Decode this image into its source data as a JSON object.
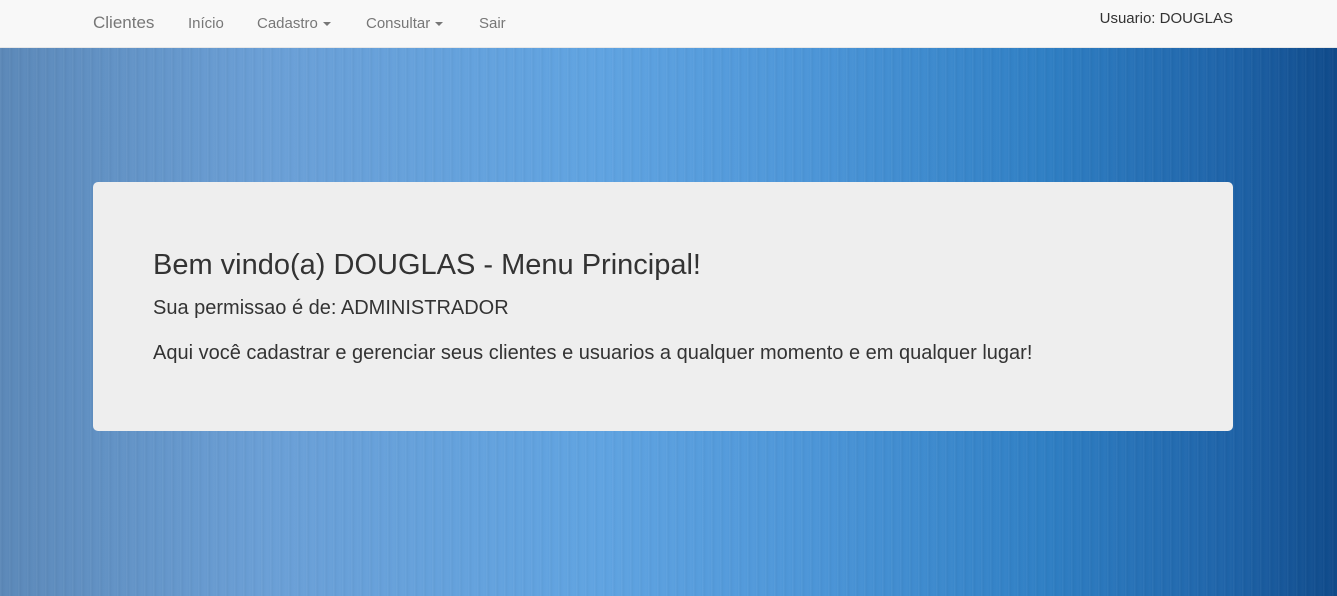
{
  "navbar": {
    "brand": "Clientes",
    "items": [
      {
        "label": "Início",
        "dropdown": false
      },
      {
        "label": "Cadastro",
        "dropdown": true
      },
      {
        "label": "Consultar",
        "dropdown": true
      },
      {
        "label": "Sair",
        "dropdown": false
      }
    ],
    "user": "Usuario: DOUGLAS"
  },
  "main": {
    "title": "Bem vindo(a) DOUGLAS - Menu Principal!",
    "permission": "Sua permissao é de: ADMINISTRADOR",
    "description": "Aqui você cadastrar e gerenciar seus clientes e usuarios a qualquer momento e em qualquer lugar!"
  },
  "colors": {
    "navbar_bg": "#f8f8f8",
    "panel_bg": "#eeeeee",
    "background_light": "#5fa3e1",
    "background_dark": "#0f4a8a"
  }
}
